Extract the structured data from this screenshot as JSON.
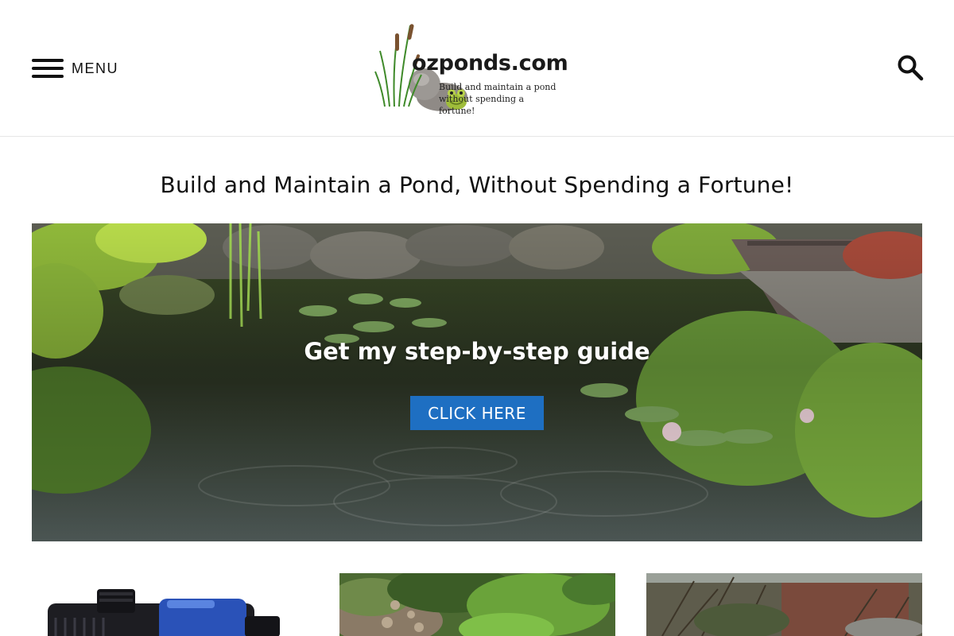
{
  "header": {
    "menu_label": "MENU",
    "logo": {
      "title": "ozponds.com",
      "tagline_line1": "Build and maintain a pond",
      "tagline_line2": "without spending a fortune!"
    },
    "search_icon": "search-icon"
  },
  "main": {
    "page_title": "Build and Maintain a Pond, Without Spending a Fortune!",
    "hero": {
      "heading": "Get my step-by-step guide",
      "cta_label": "CLICK HERE"
    },
    "cards": [
      {
        "image": "pond-pump-image"
      },
      {
        "image": "garden-pond-image"
      },
      {
        "image": "overgrown-garden-image"
      }
    ]
  },
  "colors": {
    "cta_background": "#1e6fc2",
    "text": "#111111",
    "divider": "#e6e6e6"
  }
}
